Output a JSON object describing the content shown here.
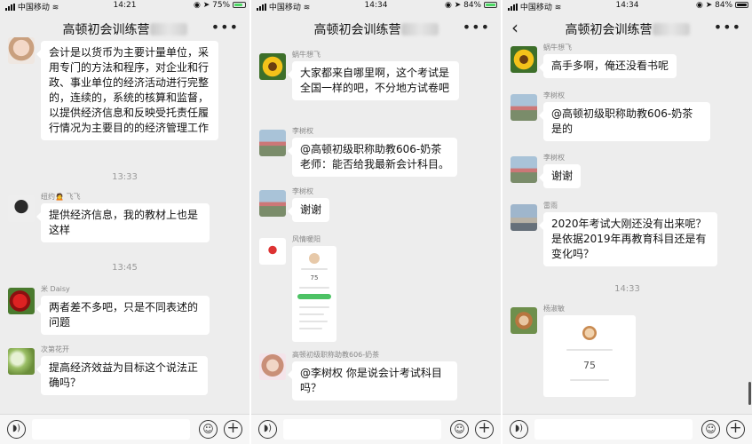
{
  "panels": [
    {
      "status": {
        "carrier": "中国移动",
        "time": "14:21",
        "battery": "75%"
      },
      "title": "高顿初会训练营",
      "messages": [
        {
          "type": "text",
          "sender": "",
          "text": "会计是以货币为主要计量单位，采用专门的方法和程序，对企业和行政、事业单位的经济活动进行完整的，连续的，系统的核算和监督，以提供经济信息和反映受托责任履行情况为主要目的的经济管理工作"
        },
        {
          "type": "time",
          "text": "13:33"
        },
        {
          "type": "text",
          "sender": "纽约🙍 飞飞",
          "text": "提供经济信息，我的教材上也是这样"
        },
        {
          "type": "time",
          "text": "13:45"
        },
        {
          "type": "text",
          "sender": "米 Daisy",
          "text": "两者差不多吧，只是不同表述的问题"
        },
        {
          "type": "text",
          "sender": "次第花开",
          "text": "提高经济效益为目标这个说法正确吗？"
        }
      ]
    },
    {
      "status": {
        "carrier": "中国移动",
        "time": "14:34",
        "battery": "84%"
      },
      "title": "高顿初会训练营",
      "messages": [
        {
          "type": "text",
          "sender": "蜗牛想飞",
          "text": "大家都来自哪里啊，这个考试是全国一样的吧，不分地方试卷吧"
        },
        {
          "type": "text",
          "sender": "李树权",
          "text": "@高顿初级职称助教606-奶茶老师：能否给我最新会计科目。"
        },
        {
          "type": "text",
          "sender": "李树权",
          "text": "谢谢"
        },
        {
          "type": "image",
          "sender": "风情暖阳",
          "score": "75"
        },
        {
          "type": "text",
          "sender": "高顿初级职称助教606-奶茶",
          "text": "@李树权 你是说会计考试科目吗？"
        }
      ]
    },
    {
      "status": {
        "carrier": "中国移动",
        "time": "14:34",
        "battery": "84%"
      },
      "title": "高顿初会训练营",
      "messages": [
        {
          "type": "text",
          "sender": "蜗牛想飞",
          "text": "高手多啊，俺还没看书呢"
        },
        {
          "type": "text",
          "sender": "李树权",
          "text": "@高顿初级职称助教606-奶茶是的"
        },
        {
          "type": "text",
          "sender": "李树权",
          "text": "谢谢"
        },
        {
          "type": "text",
          "sender": "雷雨",
          "text": "2020年考试大刚还没有出来呢？是依据2019年再教育科目还是有变化吗？"
        },
        {
          "type": "time",
          "text": "14:33"
        },
        {
          "type": "image",
          "sender": "杨淑敏",
          "score": "75"
        }
      ]
    }
  ],
  "icons": {
    "back": "back-arrow-icon",
    "more": "more-icon",
    "voice": "voice-icon",
    "emoji": "emoji-icon",
    "plus": "plus-icon"
  },
  "colors": {
    "chat_bg": "#ededed",
    "bubble": "#ffffff",
    "progress": "#4cc264"
  }
}
